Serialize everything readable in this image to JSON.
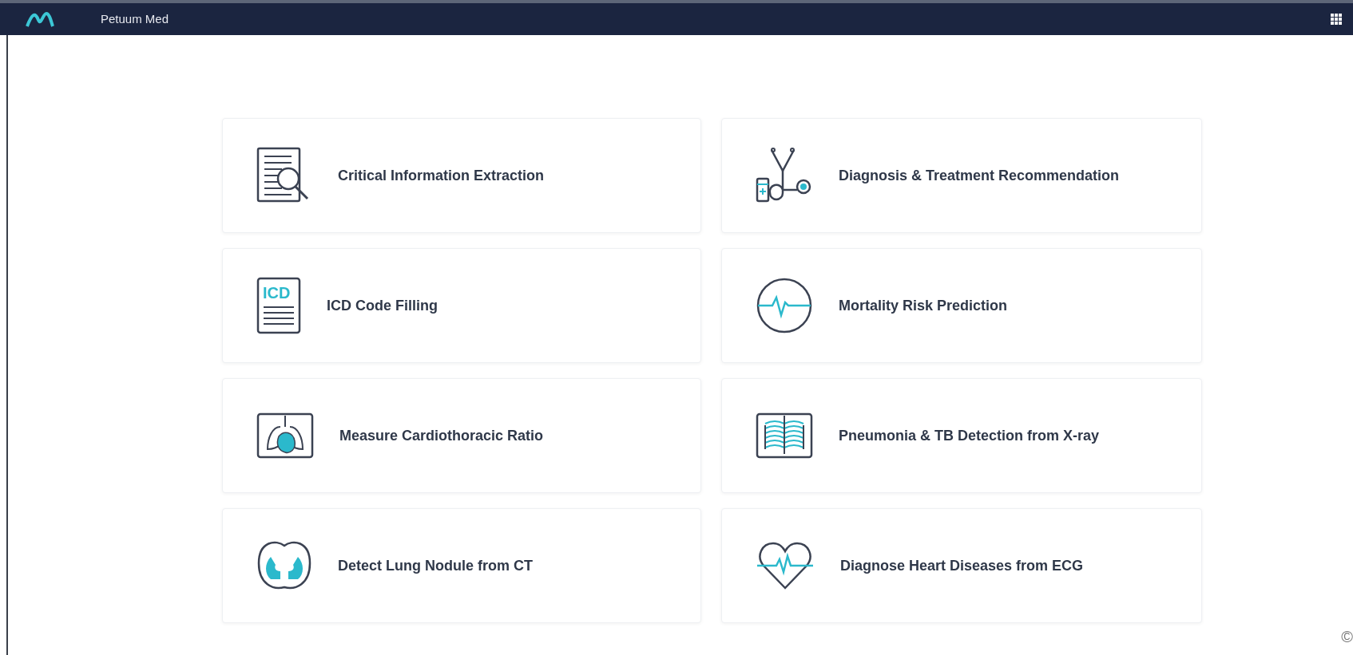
{
  "navbar": {
    "title": "Petuum Med"
  },
  "cards": [
    {
      "label": "Critical Information Extraction"
    },
    {
      "label": "Diagnosis & Treatment Recommendation"
    },
    {
      "label": "ICD Code Filling",
      "icon_text": "ICD"
    },
    {
      "label": "Mortality Risk Prediction"
    },
    {
      "label": "Measure Cardiothoracic Ratio"
    },
    {
      "label": "Pneumonia & TB Detection from X-ray"
    },
    {
      "label": "Detect Lung Nodule from CT"
    },
    {
      "label": "Diagnose Heart Diseases from ECG"
    }
  ],
  "footer": {
    "text": "©"
  }
}
